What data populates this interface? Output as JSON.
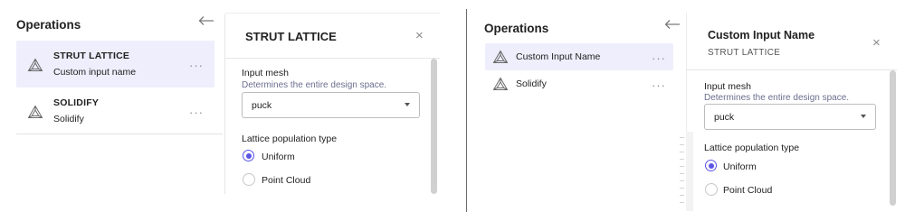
{
  "left": {
    "operations": {
      "title": "Operations",
      "back_icon": "arrow-left-icon",
      "items": [
        {
          "name": "STRUT LATTICE",
          "subtitle": "Custom input name",
          "selected": true,
          "icon": "triangle-mesh-icon",
          "more": "···"
        },
        {
          "name": "SOLIDIFY",
          "subtitle": "Solidify",
          "selected": false,
          "icon": "triangle-mesh-icon",
          "more": "···"
        }
      ]
    },
    "panel": {
      "title": "STRUT LATTICE",
      "close_icon": "close-icon",
      "close_glyph": "×",
      "input_mesh": {
        "label": "Input mesh",
        "help": "Determines the entire design space.",
        "value": "puck"
      },
      "lattice_population": {
        "label": "Lattice population type",
        "options": [
          {
            "label": "Uniform",
            "checked": true
          },
          {
            "label": "Point Cloud",
            "checked": false
          }
        ]
      }
    }
  },
  "right": {
    "operations": {
      "title": "Operations",
      "back_icon": "arrow-left-icon",
      "items": [
        {
          "label": "Custom Input Name",
          "selected": true,
          "icon": "triangle-mesh-icon",
          "more": "···"
        },
        {
          "label": "Solidify",
          "selected": false,
          "icon": "triangle-mesh-icon",
          "more": "···"
        }
      ]
    },
    "panel": {
      "title": "Custom Input Name",
      "subtitle": "STRUT LATTICE",
      "close_icon": "close-icon",
      "close_glyph": "×",
      "input_mesh": {
        "label": "Input mesh",
        "help": "Determines the entire design space.",
        "value": "puck"
      },
      "lattice_population": {
        "label": "Lattice population type",
        "options": [
          {
            "label": "Uniform",
            "checked": true
          },
          {
            "label": "Point Cloud",
            "checked": false
          }
        ]
      }
    }
  },
  "colors": {
    "accent": "#5b55e6",
    "selected_bg": "#eeeefc",
    "help_text": "#6b6f8f"
  }
}
